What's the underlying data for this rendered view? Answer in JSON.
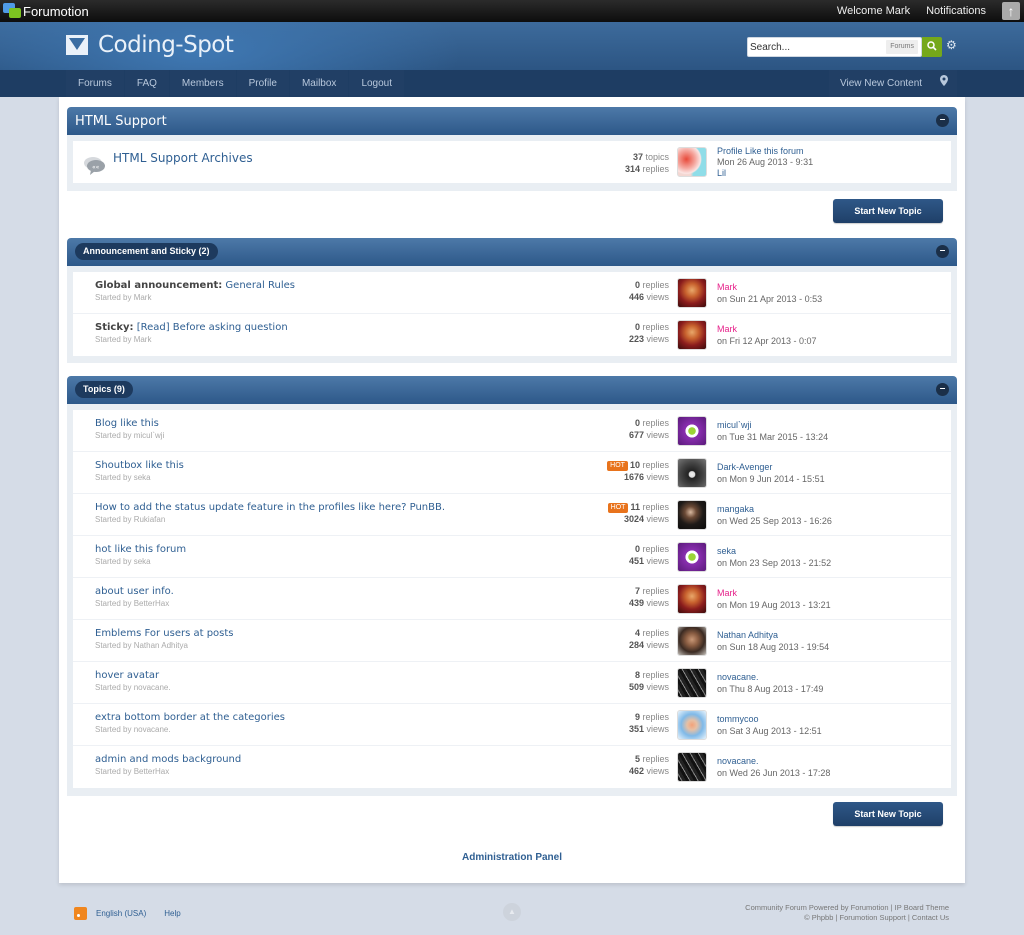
{
  "topbar": {
    "brand": "Forumotion",
    "welcome": "Welcome Mark",
    "notifications": "Notifications"
  },
  "header": {
    "site_name": "Coding-Spot",
    "search_placeholder": "Search...",
    "search_scope": "Forums"
  },
  "nav": {
    "tabs": [
      "Forums",
      "FAQ",
      "Members",
      "Profile",
      "Mailbox",
      "Logout"
    ],
    "view_new_content": "View New Content"
  },
  "forum_section": {
    "title": "HTML Support",
    "forums": [
      {
        "name": "HTML Support Archives",
        "topics": "37",
        "topics_label": "topics",
        "replies": "314",
        "replies_label": "replies",
        "last_post_title": "Profile Like this forum",
        "last_post_date": "Mon 26 Aug 2013 - 9:31",
        "last_post_user": "Lil"
      }
    ]
  },
  "buttons": {
    "start_new_topic": "Start New Topic"
  },
  "announcements": {
    "title": "Announcement and Sticky (2)",
    "items": [
      {
        "prefix": "Global announcement:",
        "title": "General Rules",
        "starter": "Started by Mark",
        "replies": "0",
        "views": "446",
        "last_user": "Mark",
        "last_user_admin": true,
        "last_date": "on Sun 21 Apr 2013 - 0:53",
        "hot": false
      },
      {
        "prefix": "Sticky:",
        "title": "[Read] Before asking question",
        "starter": "Started by Mark",
        "replies": "0",
        "views": "223",
        "last_user": "Mark",
        "last_user_admin": true,
        "last_date": "on Fri 12 Apr 2013 - 0:07",
        "hot": false
      }
    ]
  },
  "topics": {
    "title": "Topics (9)",
    "items": [
      {
        "prefix": "",
        "title": "Blog like this",
        "starter": "Started by micul`wji",
        "replies": "0",
        "views": "677",
        "last_user": "micul`wji",
        "last_user_admin": false,
        "last_date": "on Tue 31 Mar 2015 - 13:24",
        "hot": false
      },
      {
        "prefix": "",
        "title": "Shoutbox like this",
        "starter": "Started by seka",
        "replies": "10",
        "views": "1676",
        "last_user": "Dark-Avenger",
        "last_user_admin": false,
        "last_date": "on Mon 9 Jun 2014 - 15:51",
        "hot": true
      },
      {
        "prefix": "",
        "title": "How to add the status update feature in the profiles like here? PunBB.",
        "starter": "Started by Rukiafan",
        "replies": "11",
        "views": "3024",
        "last_user": "mangaka",
        "last_user_admin": false,
        "last_date": "on Wed 25 Sep 2013 - 16:26",
        "hot": true
      },
      {
        "prefix": "",
        "title": "hot like this forum",
        "starter": "Started by seka",
        "replies": "0",
        "views": "451",
        "last_user": "seka",
        "last_user_admin": false,
        "last_date": "on Mon 23 Sep 2013 - 21:52",
        "hot": false
      },
      {
        "prefix": "",
        "title": "about user info.",
        "starter": "Started by BetterHax",
        "replies": "7",
        "views": "439",
        "last_user": "Mark",
        "last_user_admin": true,
        "last_date": "on Mon 19 Aug 2013 - 13:21",
        "hot": false
      },
      {
        "prefix": "",
        "title": "Emblems For users at posts",
        "starter": "Started by Nathan Adhitya",
        "replies": "4",
        "views": "284",
        "last_user": "Nathan Adhitya",
        "last_user_admin": false,
        "last_date": "on Sun 18 Aug 2013 - 19:54",
        "hot": false
      },
      {
        "prefix": "",
        "title": "hover avatar",
        "starter": "Started by novacane.",
        "replies": "8",
        "views": "509",
        "last_user": "novacane.",
        "last_user_admin": false,
        "last_date": "on Thu 8 Aug 2013 - 17:49",
        "hot": false
      },
      {
        "prefix": "",
        "title": "extra bottom border at the categories",
        "starter": "Started by novacane.",
        "replies": "9",
        "views": "351",
        "last_user": "tommycoo",
        "last_user_admin": false,
        "last_date": "on Sat 3 Aug 2013 - 12:51",
        "hot": false
      },
      {
        "prefix": "",
        "title": "admin and mods background",
        "starter": "Started by BetterHax",
        "replies": "5",
        "views": "462",
        "last_user": "novacane.",
        "last_user_admin": false,
        "last_date": "on Wed 26 Jun 2013 - 17:28",
        "hot": false
      }
    ]
  },
  "labels": {
    "replies": "replies",
    "views": "views",
    "hot": "HOT"
  },
  "admin_panel": "Administration Panel",
  "footer": {
    "language": "English (USA)",
    "help": "Help",
    "credits_line1": "Community Forum Powered by Forumotion | IP Board Theme",
    "credits_line2": "© Phpbb | Forumotion Support | Contact Us"
  },
  "colors": {
    "brand_blue": "#2c5583",
    "nav_dark": "#1e3d63",
    "link": "#2f5f92",
    "admin_name": "#e6228a",
    "hot_badge": "#e8731c",
    "search_green": "#75a81b"
  }
}
